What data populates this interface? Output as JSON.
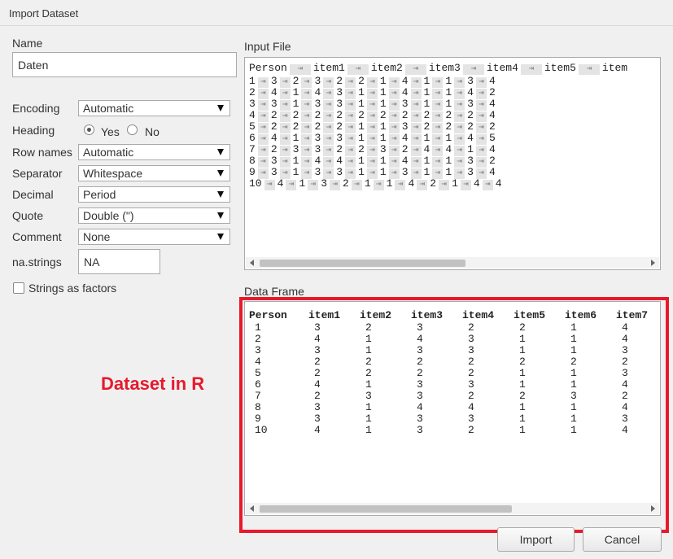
{
  "window": {
    "title": "Import Dataset"
  },
  "form": {
    "name_label": "Name",
    "name_value": "Daten",
    "encoding_label": "Encoding",
    "encoding_value": "Automatic",
    "heading_label": "Heading",
    "heading_yes": "Yes",
    "heading_no": "No",
    "heading_selected": "Yes",
    "rownames_label": "Row names",
    "rownames_value": "Automatic",
    "separator_label": "Separator",
    "separator_value": "Whitespace",
    "decimal_label": "Decimal",
    "decimal_value": "Period",
    "quote_label": "Quote",
    "quote_value": "Double (\")",
    "comment_label": "Comment",
    "comment_value": "None",
    "nastrings_label": "na.strings",
    "nastrings_value": "NA",
    "strings_as_factors_label": "Strings as factors",
    "strings_as_factors_checked": false
  },
  "input_file": {
    "label": "Input File",
    "tab_glyph": "⇥",
    "lines": [
      [
        "Person",
        "item1",
        "item2",
        "item3",
        "item4",
        "item5",
        "item"
      ],
      [
        "1",
        "3",
        "2",
        "3",
        "2",
        "2",
        "1",
        "4",
        "1",
        "1",
        "3",
        "4"
      ],
      [
        "2",
        "4",
        "1",
        "4",
        "3",
        "1",
        "1",
        "4",
        "1",
        "1",
        "4",
        "2"
      ],
      [
        "3",
        "3",
        "1",
        "3",
        "3",
        "1",
        "1",
        "3",
        "1",
        "1",
        "3",
        "4"
      ],
      [
        "4",
        "2",
        "2",
        "2",
        "2",
        "2",
        "2",
        "2",
        "2",
        "2",
        "2",
        "4"
      ],
      [
        "5",
        "2",
        "2",
        "2",
        "2",
        "1",
        "1",
        "3",
        "2",
        "2",
        "2",
        "2"
      ],
      [
        "6",
        "4",
        "1",
        "3",
        "3",
        "1",
        "1",
        "4",
        "1",
        "1",
        "4",
        "5"
      ],
      [
        "7",
        "2",
        "3",
        "3",
        "2",
        "2",
        "3",
        "2",
        "4",
        "4",
        "1",
        "4"
      ],
      [
        "8",
        "3",
        "1",
        "4",
        "4",
        "1",
        "1",
        "4",
        "1",
        "1",
        "3",
        "2"
      ],
      [
        "9",
        "3",
        "1",
        "3",
        "3",
        "1",
        "1",
        "3",
        "1",
        "1",
        "3",
        "4"
      ],
      [
        "10",
        "4",
        "1",
        "3",
        "2",
        "1",
        "1",
        "4",
        "2",
        "1",
        "4",
        "4"
      ]
    ]
  },
  "data_frame": {
    "label": "Data Frame",
    "columns": [
      "Person",
      "item1",
      "item2",
      "item3",
      "item4",
      "item5",
      "item6",
      "item7"
    ],
    "rows": [
      [
        "1",
        "3",
        "2",
        "3",
        "2",
        "2",
        "1",
        "4"
      ],
      [
        "2",
        "4",
        "1",
        "4",
        "3",
        "1",
        "1",
        "4"
      ],
      [
        "3",
        "3",
        "1",
        "3",
        "3",
        "1",
        "1",
        "3"
      ],
      [
        "4",
        "2",
        "2",
        "2",
        "2",
        "2",
        "2",
        "2"
      ],
      [
        "5",
        "2",
        "2",
        "2",
        "2",
        "1",
        "1",
        "3"
      ],
      [
        "6",
        "4",
        "1",
        "3",
        "3",
        "1",
        "1",
        "4"
      ],
      [
        "7",
        "2",
        "3",
        "3",
        "2",
        "2",
        "3",
        "2"
      ],
      [
        "8",
        "3",
        "1",
        "4",
        "4",
        "1",
        "1",
        "4"
      ],
      [
        "9",
        "3",
        "1",
        "3",
        "3",
        "1",
        "1",
        "3"
      ],
      [
        "10",
        "4",
        "1",
        "3",
        "2",
        "1",
        "1",
        "4"
      ]
    ]
  },
  "annotation": {
    "text": "Dataset in R",
    "color": "#e8192c"
  },
  "buttons": {
    "import": "Import",
    "cancel": "Cancel"
  }
}
